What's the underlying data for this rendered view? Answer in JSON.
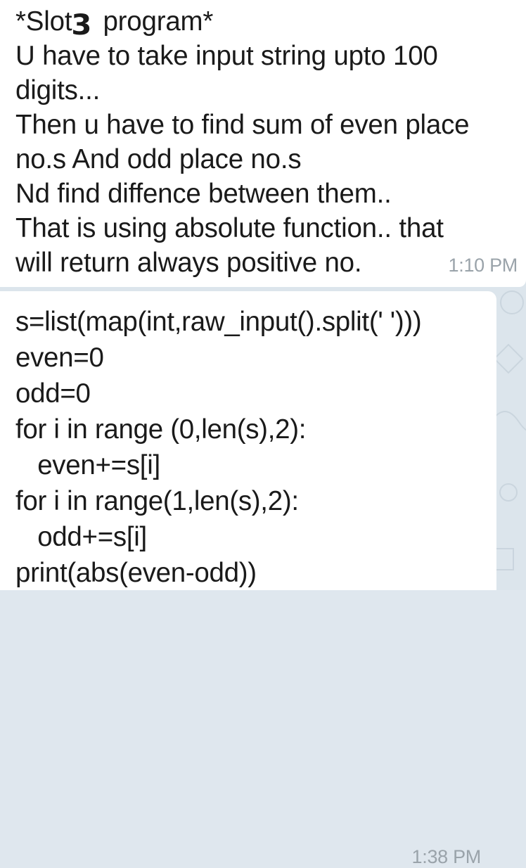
{
  "messages": [
    {
      "title_prefix": "*Slot",
      "title_digit": "3",
      "title_suffix": " program*",
      "lines": [
        "U have to take input string upto 100",
        "digits...",
        "Then u have to find sum of even place",
        "no.s And odd place no.s",
        "Nd find diffence between them..",
        "That is using absolute function.. that",
        "will return always positive no."
      ],
      "time": "1:10 PM"
    },
    {
      "lines": [
        "s=list(map(int,raw_input().split(' ')))",
        "even=0",
        "odd=0",
        "for i in range (0,len(s),2):",
        "   even+=s[i]",
        "for i in range(1,len(s),2):",
        "   odd+=s[i]",
        "print(abs(even-odd))"
      ],
      "time": "1:38 PM"
    }
  ],
  "colors": {
    "bubble": "#ffffff",
    "background": "#dce5ec",
    "timestamp": "#9aa3aa",
    "text": "#1a1a1a"
  }
}
